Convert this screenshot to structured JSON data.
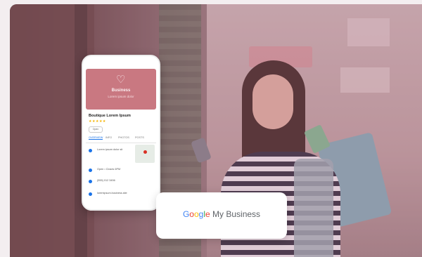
{
  "phone": {
    "header_name": "Business",
    "header_sub": "Lorem ipsum dolor",
    "business_title": "Boutique Lorem Ipsum",
    "rating_stars": "★★★★★",
    "chip": "Open",
    "tabs": [
      "OVERVIEW",
      "INFO",
      "PHOTOS",
      "POSTS"
    ],
    "rows": [
      "Lorem ipsum dolor sit",
      "Open • Closes 6PM",
      "(555) 012 3456",
      "loremipsum.business.site"
    ]
  },
  "badge": {
    "google_letters": [
      "G",
      "o",
      "o",
      "g",
      "l",
      "e"
    ],
    "suffix": " My Business"
  }
}
